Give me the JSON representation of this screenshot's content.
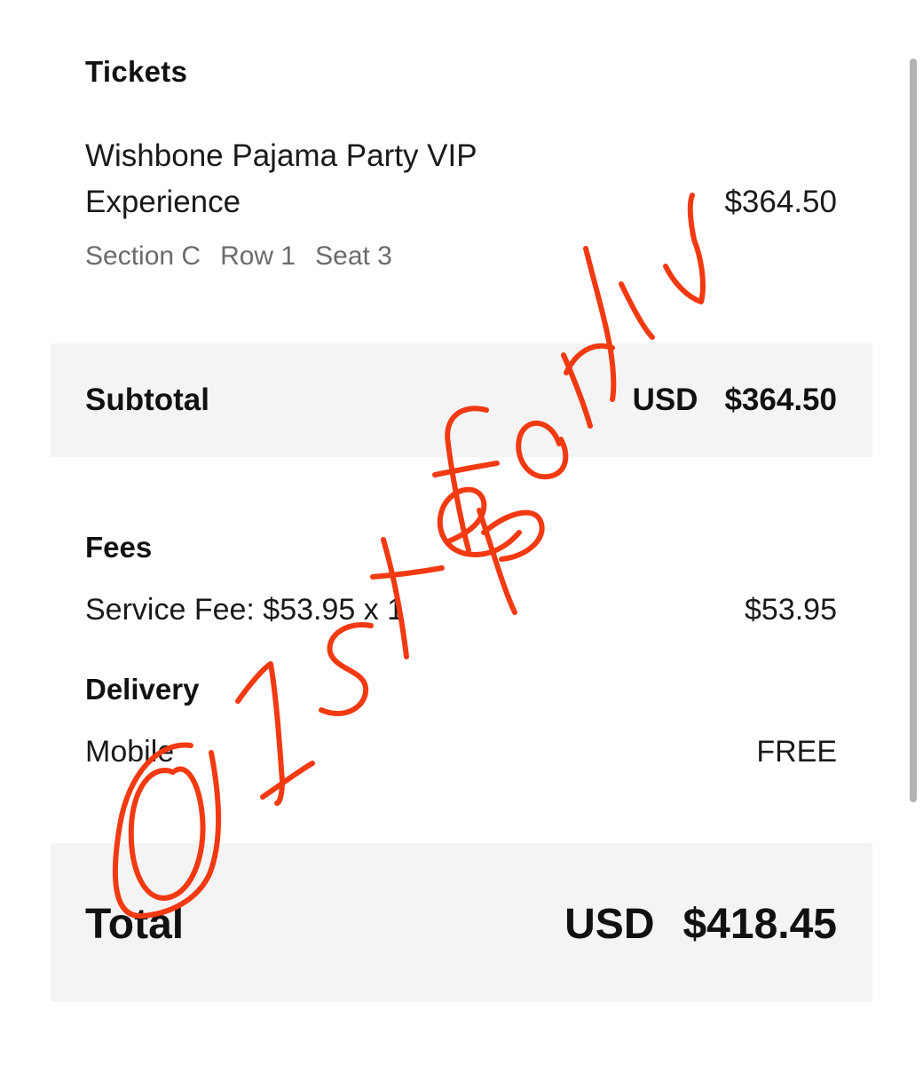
{
  "tickets": {
    "header": "Tickets",
    "event_name": "Wishbone Pajama Party VIP Experience",
    "price": "$364.50",
    "section": "Section C",
    "row": "Row 1",
    "seat": "Seat 3"
  },
  "subtotal": {
    "label": "Subtotal",
    "currency": "USD",
    "amount": "$364.50"
  },
  "fees": {
    "header": "Fees",
    "service_fee_label": "Service Fee: $53.95 x 1",
    "service_fee_amount": "$53.95"
  },
  "delivery": {
    "header": "Delivery",
    "method": "Mobile",
    "cost": "FREE"
  },
  "total": {
    "label": "Total",
    "currency": "USD",
    "amount": "$418.45"
  },
  "watermark": {
    "text": "@1stepforliv",
    "color": "#f23a12"
  }
}
